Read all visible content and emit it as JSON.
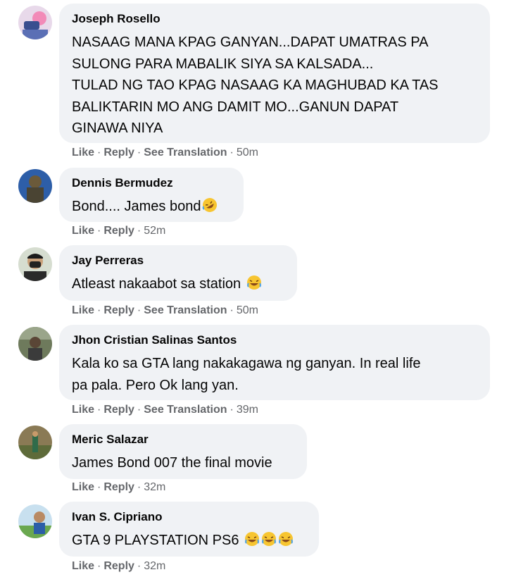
{
  "actions": {
    "like": "Like",
    "reply": "Reply",
    "see_translation": "See Translation"
  },
  "comments": [
    {
      "author": "Joseph Rosello",
      "lines": [
        "NASAAG MANA KPAG GANYAN...DAPAT UMATRAS PA",
        "SULONG PARA MABALIK SIYA SA KALSADA...",
        "TULAD NG TAO KPAG NASAAG KA MAGHUBAD KA TAS",
        "BALIKTARIN MO ANG DAMIT MO...GANUN DAPAT",
        "GINAWA NIYA"
      ],
      "time": "50m",
      "has_translation": true
    },
    {
      "author": "Dennis Bermudez",
      "lines": [
        "Bond.... James bond"
      ],
      "emoji": [
        "rofl"
      ],
      "time": "52m",
      "has_translation": false
    },
    {
      "author": "Jay Perreras",
      "lines": [
        "Atleast nakaabot sa station "
      ],
      "emoji": [
        "joy"
      ],
      "time": "50m",
      "has_translation": true
    },
    {
      "author": "Jhon Cristian Salinas Santos",
      "lines": [
        "Kala ko sa GTA lang nakakagawa ng ganyan. In real life",
        "pa pala. Pero Ok lang yan."
      ],
      "time": "39m",
      "has_translation": true
    },
    {
      "author": "Meric Salazar",
      "lines": [
        "James Bond 007 the final movie"
      ],
      "time": "32m",
      "has_translation": false
    },
    {
      "author": "Ivan S. Cipriano",
      "lines": [
        "GTA 9 PLAYSTATION PS6 "
      ],
      "emoji": [
        "joy",
        "joy",
        "joy"
      ],
      "time": "32m",
      "has_translation": false
    }
  ]
}
